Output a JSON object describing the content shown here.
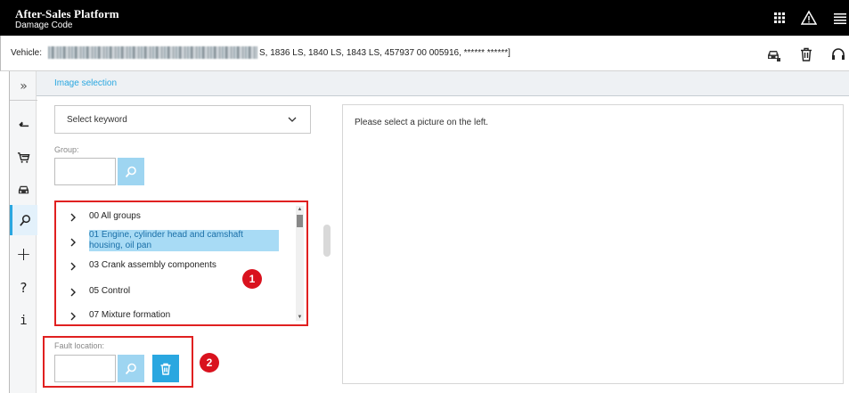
{
  "header": {
    "title": "After-Sales Platform",
    "subtitle": "Damage Code",
    "icons": [
      "grid-icon",
      "warning-icon",
      "menu-icon"
    ]
  },
  "vehicle_bar": {
    "label": "Vehicle:",
    "text": "S, 1836 LS, 1840 LS, 1843 LS, 457937 00 005916, ****** ******]",
    "icons": [
      "car-icon",
      "trash-icon",
      "headset-icon"
    ]
  },
  "rail": {
    "items": [
      "expand-icon",
      "back-icon",
      "cart-icon",
      "car-icon",
      "search-icon",
      "plus-icon",
      "help-icon",
      "info-icon"
    ],
    "expand_glyph": "»",
    "plus_glyph": "+",
    "help_glyph": "?",
    "info_glyph": "i"
  },
  "section": {
    "title": "Image selection"
  },
  "keyword_select": {
    "value": "Select keyword"
  },
  "group": {
    "label": "Group:",
    "value": ""
  },
  "tree": {
    "items": [
      {
        "label": "00 All groups",
        "selected": false
      },
      {
        "label": "01 Engine, cylinder head and camshaft housing, oil pan",
        "selected": true
      },
      {
        "label": "03 Crank assembly components",
        "selected": false
      },
      {
        "label": "05 Control",
        "selected": false
      },
      {
        "label": "07 Mixture formation",
        "selected": false
      }
    ]
  },
  "fault_location": {
    "label": "Fault location:",
    "value": ""
  },
  "badges": [
    "1",
    "2"
  ],
  "right_panel": {
    "message": "Please select a picture on the left."
  },
  "colors": {
    "accent": "#2aa7e0",
    "accent_light": "#9ed5f1",
    "annotation": "#e02020",
    "header_bg": "#000000"
  }
}
